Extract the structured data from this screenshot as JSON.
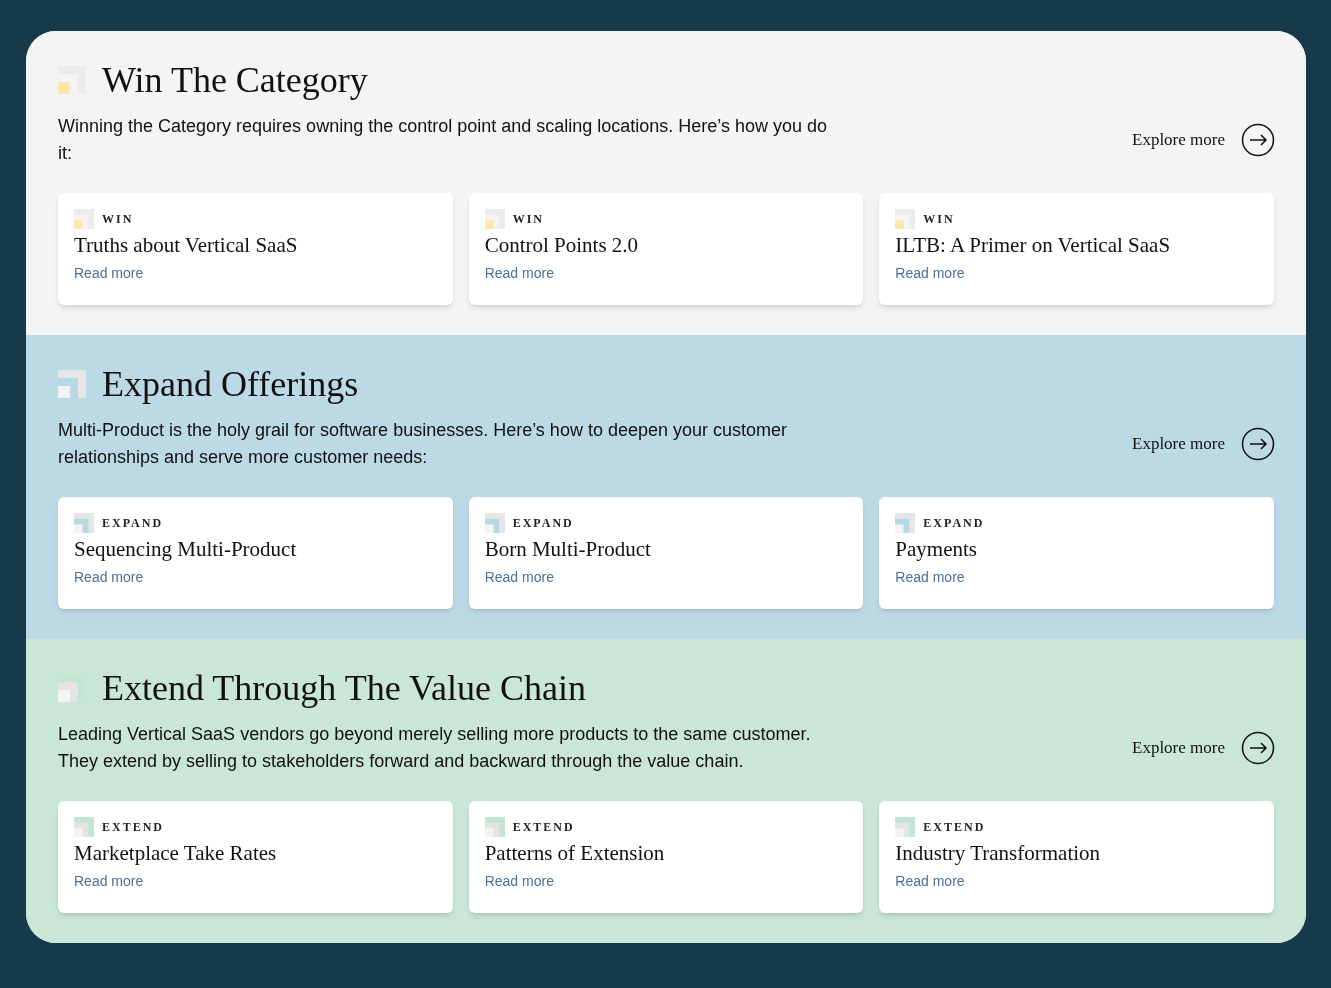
{
  "sections": [
    {
      "kind": "win",
      "title": "Win The Category",
      "description": "Winning the Category requires owning the control point and scaling locations. Here’s how you do it:",
      "explore": "Explore more",
      "cards": [
        {
          "tag": "WIN",
          "title": "Truths about Vertical SaaS",
          "link": "Read more"
        },
        {
          "tag": "WIN",
          "title": "Control Points 2.0",
          "link": "Read more"
        },
        {
          "tag": "WIN",
          "title": "ILTB: A Primer on Vertical SaaS",
          "link": "Read more"
        }
      ]
    },
    {
      "kind": "expand",
      "title": "Expand Offerings",
      "description": "Multi-Product is the holy grail for software businesses. Here’s how to deepen your customer relationships and serve more customer needs:",
      "explore": "Explore more",
      "cards": [
        {
          "tag": "EXPAND",
          "title": "Sequencing Multi-Product",
          "link": "Read more"
        },
        {
          "tag": "EXPAND",
          "title": "Born Multi-Product",
          "link": "Read more"
        },
        {
          "tag": "EXPAND",
          "title": "Payments",
          "link": "Read more"
        }
      ]
    },
    {
      "kind": "extend",
      "title": "Extend Through The Value Chain",
      "description": "Leading Vertical SaaS vendors go beyond merely selling more products to the same customer. They extend by selling to stakeholders forward and backward through the value chain.",
      "explore": "Explore more",
      "cards": [
        {
          "tag": "EXTEND",
          "title": "Marketplace Take Rates",
          "link": "Read more"
        },
        {
          "tag": "EXTEND",
          "title": "Patterns of Extension",
          "link": "Read more"
        },
        {
          "tag": "EXTEND",
          "title": "Industry Transformation",
          "link": "Read more"
        }
      ]
    }
  ]
}
